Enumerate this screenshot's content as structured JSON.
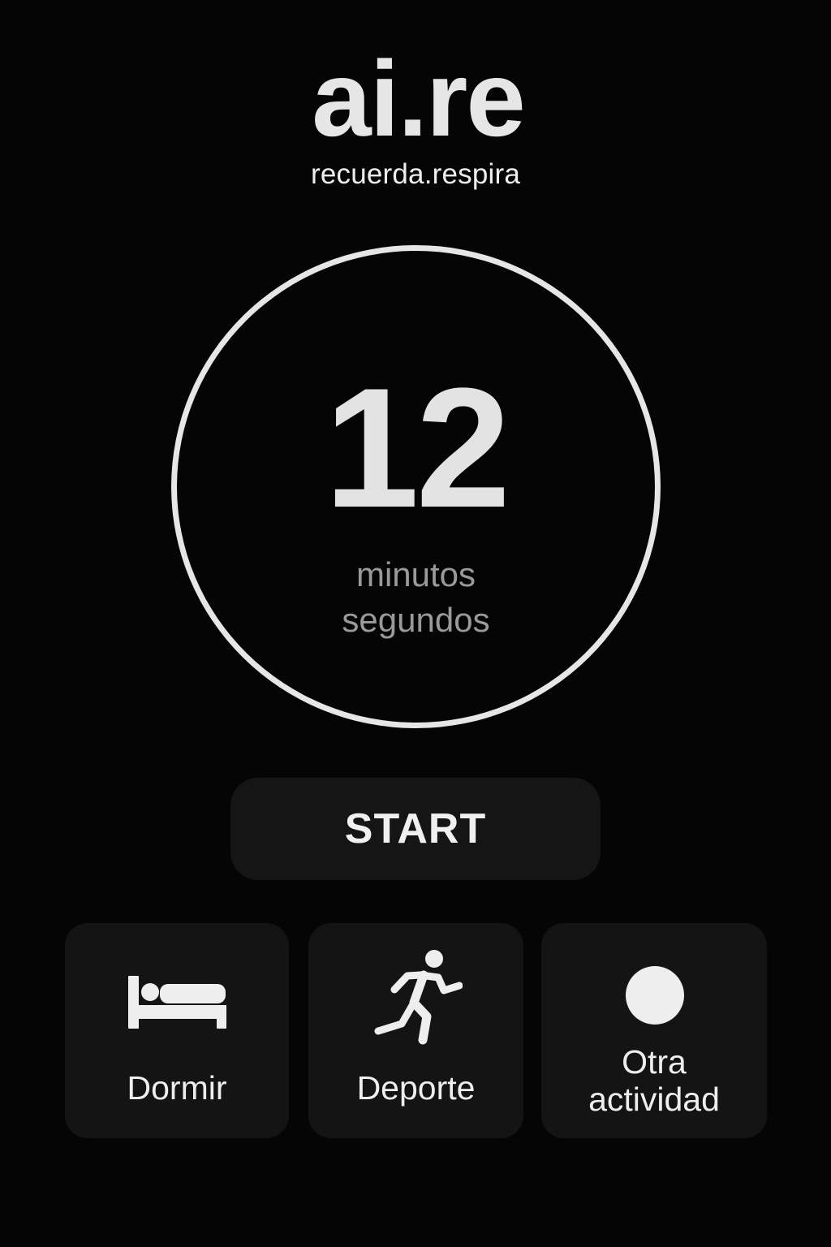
{
  "brand": {
    "logo": "ai.re",
    "tagline": "recuerda.respira"
  },
  "timer": {
    "value": "12",
    "units": [
      "minutos",
      "segundos"
    ]
  },
  "actions": {
    "start_label": "START"
  },
  "activities": [
    {
      "label": "Dormir",
      "icon": "bed-icon"
    },
    {
      "label": "Deporte",
      "icon": "runner-icon"
    },
    {
      "label_lines": [
        "Otra",
        "actividad"
      ],
      "icon": "circle-icon"
    }
  ],
  "colors": {
    "background": "#050505",
    "card": "#141414",
    "button": "#151515",
    "foreground": "#e6e6e6",
    "muted_text": "#9a9a9a"
  }
}
